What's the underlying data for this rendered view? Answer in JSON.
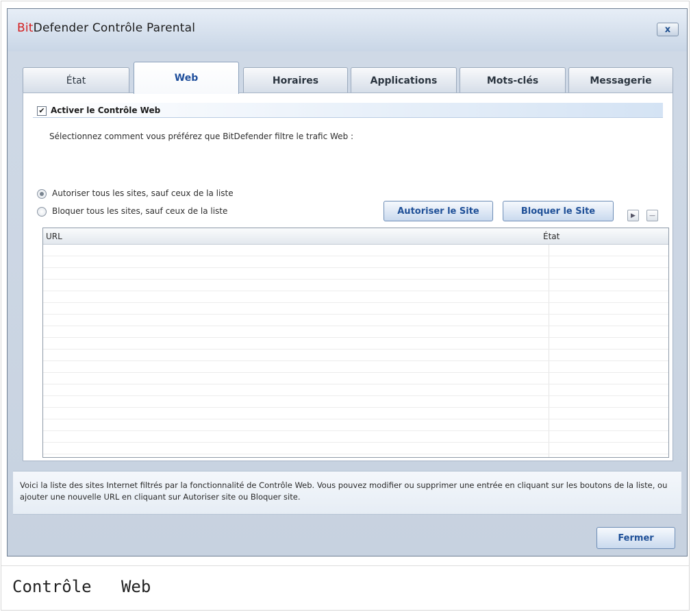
{
  "window": {
    "title_brand": "Bit",
    "title_rest": "Defender Contrôle Parental",
    "close_label": "x"
  },
  "tabs": [
    {
      "label": "État",
      "active": false
    },
    {
      "label": "Web",
      "active": true
    },
    {
      "label": "Horaires",
      "active": false
    },
    {
      "label": "Applications",
      "active": false
    },
    {
      "label": "Mots-clés",
      "active": false
    },
    {
      "label": "Messagerie",
      "active": false
    }
  ],
  "web_control": {
    "enable_label": "Activer le Contrôle Web",
    "enabled": true,
    "description": "Sélectionnez comment vous préférez que BitDefender filtre le trafic Web :",
    "radio_allow_label": "Autoriser tous les sites, sauf ceux de la liste",
    "radio_block_label": "Bloquer tous les sites, sauf ceux de la liste",
    "selected_mode": "allow",
    "allow_site_button": "Autoriser le Site",
    "block_site_button": "Bloquer le Site",
    "edit_icon": "play-small-icon",
    "remove_icon": "minus-icon"
  },
  "table": {
    "columns": [
      "URL",
      "État"
    ],
    "rows": []
  },
  "info_text": "Voici la liste des sites Internet filtrés par la fonctionnalité de Contrôle Web. Vous pouvez modifier ou supprimer une entrée en cliquant sur les boutons de la liste, ou ajouter une nouvelle URL en cliquant sur Autoriser site ou Bloquer site.",
  "footer": {
    "close_button": "Fermer"
  },
  "caption": "Contrôle   Web",
  "colors": {
    "brand_red": "#d41c1c",
    "accent_blue": "#1e4f97"
  }
}
